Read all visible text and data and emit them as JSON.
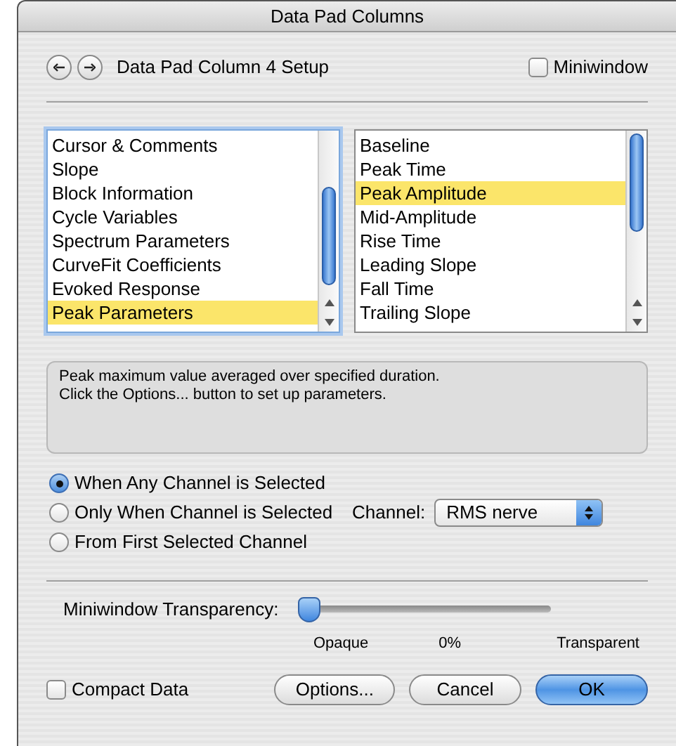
{
  "window": {
    "title": "Data Pad Columns"
  },
  "header": {
    "title": "Data Pad Column 4 Setup",
    "miniwindow": {
      "label": "Miniwindow",
      "checked": false
    }
  },
  "category_list": [
    {
      "label": "Cursor & Comments",
      "selected": false
    },
    {
      "label": "Slope",
      "selected": false
    },
    {
      "label": "Block Information",
      "selected": false
    },
    {
      "label": "Cycle Variables",
      "selected": false
    },
    {
      "label": "Spectrum Parameters",
      "selected": false
    },
    {
      "label": "CurveFit Coefficients",
      "selected": false
    },
    {
      "label": "Evoked Response",
      "selected": false
    },
    {
      "label": "Peak Parameters",
      "selected": true
    }
  ],
  "measure_list": [
    {
      "label": "Baseline",
      "selected": false
    },
    {
      "label": "Peak Time",
      "selected": false
    },
    {
      "label": "Peak Amplitude",
      "selected": true
    },
    {
      "label": "Mid-Amplitude",
      "selected": false
    },
    {
      "label": "Rise Time",
      "selected": false
    },
    {
      "label": "Leading Slope",
      "selected": false
    },
    {
      "label": "Fall Time",
      "selected": false
    },
    {
      "label": "Trailing Slope",
      "selected": false
    }
  ],
  "description": [
    "Peak maximum value averaged over specified duration.",
    "Click the Options... button to set up parameters."
  ],
  "channel_options": [
    {
      "label": "When Any Channel is Selected",
      "selected": true
    },
    {
      "label": "Only When Channel is Selected",
      "selected": false
    },
    {
      "label": "From First Selected Channel",
      "selected": false
    }
  ],
  "channel_select": {
    "label": "Channel:",
    "value": "RMS nerve"
  },
  "transparency": {
    "label": "Miniwindow Transparency:",
    "level": 0,
    "min_label": "Opaque",
    "reading": "0%",
    "max_label": "Transparent"
  },
  "compact_data": {
    "label": "Compact Data",
    "checked": false
  },
  "buttons": [
    {
      "label": "Options...",
      "kind": "plain"
    },
    {
      "label": "Cancel",
      "kind": "plain"
    },
    {
      "label": "OK",
      "kind": "default"
    }
  ]
}
